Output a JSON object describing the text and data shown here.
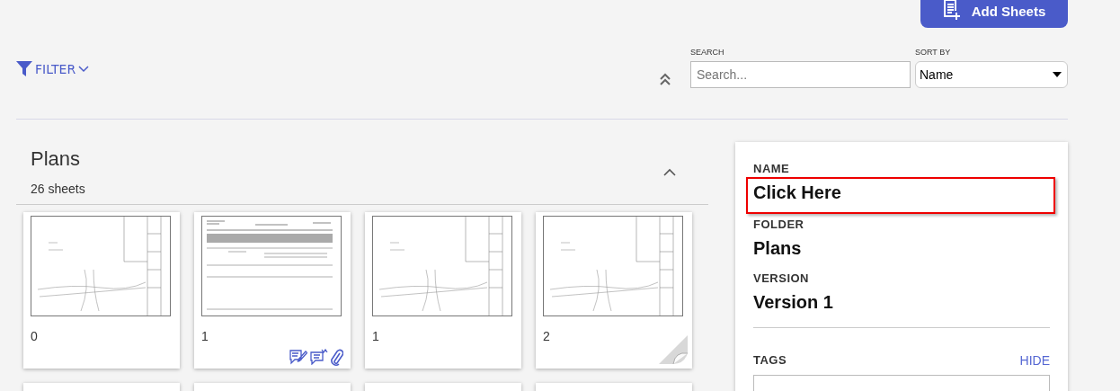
{
  "toolbar": {
    "add_button": "Add Sheets"
  },
  "filter": {
    "label": "FILTER"
  },
  "search": {
    "label": "SEARCH",
    "placeholder": "Search..."
  },
  "sort": {
    "label": "SORT BY",
    "value": "Name"
  },
  "folder": {
    "title": "Plans",
    "count": "26 sheets",
    "expanded": true
  },
  "sheets": [
    {
      "label": "0",
      "kind": "plan",
      "markup": false,
      "comments": false,
      "attachment": false,
      "curl": false
    },
    {
      "label": "1",
      "kind": "report",
      "markup": true,
      "comments": true,
      "attachment": true,
      "curl": false
    },
    {
      "label": "1",
      "kind": "plan",
      "markup": false,
      "comments": false,
      "attachment": false,
      "curl": false
    },
    {
      "label": "2",
      "kind": "plan",
      "markup": false,
      "comments": false,
      "attachment": false,
      "curl": true
    }
  ],
  "details": {
    "fields": [
      {
        "label": "NAME",
        "value": "Click Here",
        "highlighted": true
      },
      {
        "label": "FOLDER",
        "value": "Plans",
        "highlighted": false
      },
      {
        "label": "VERSION",
        "value": "Version 1",
        "highlighted": false
      }
    ],
    "tags": {
      "label": "TAGS",
      "toggle": "HIDE"
    }
  }
}
